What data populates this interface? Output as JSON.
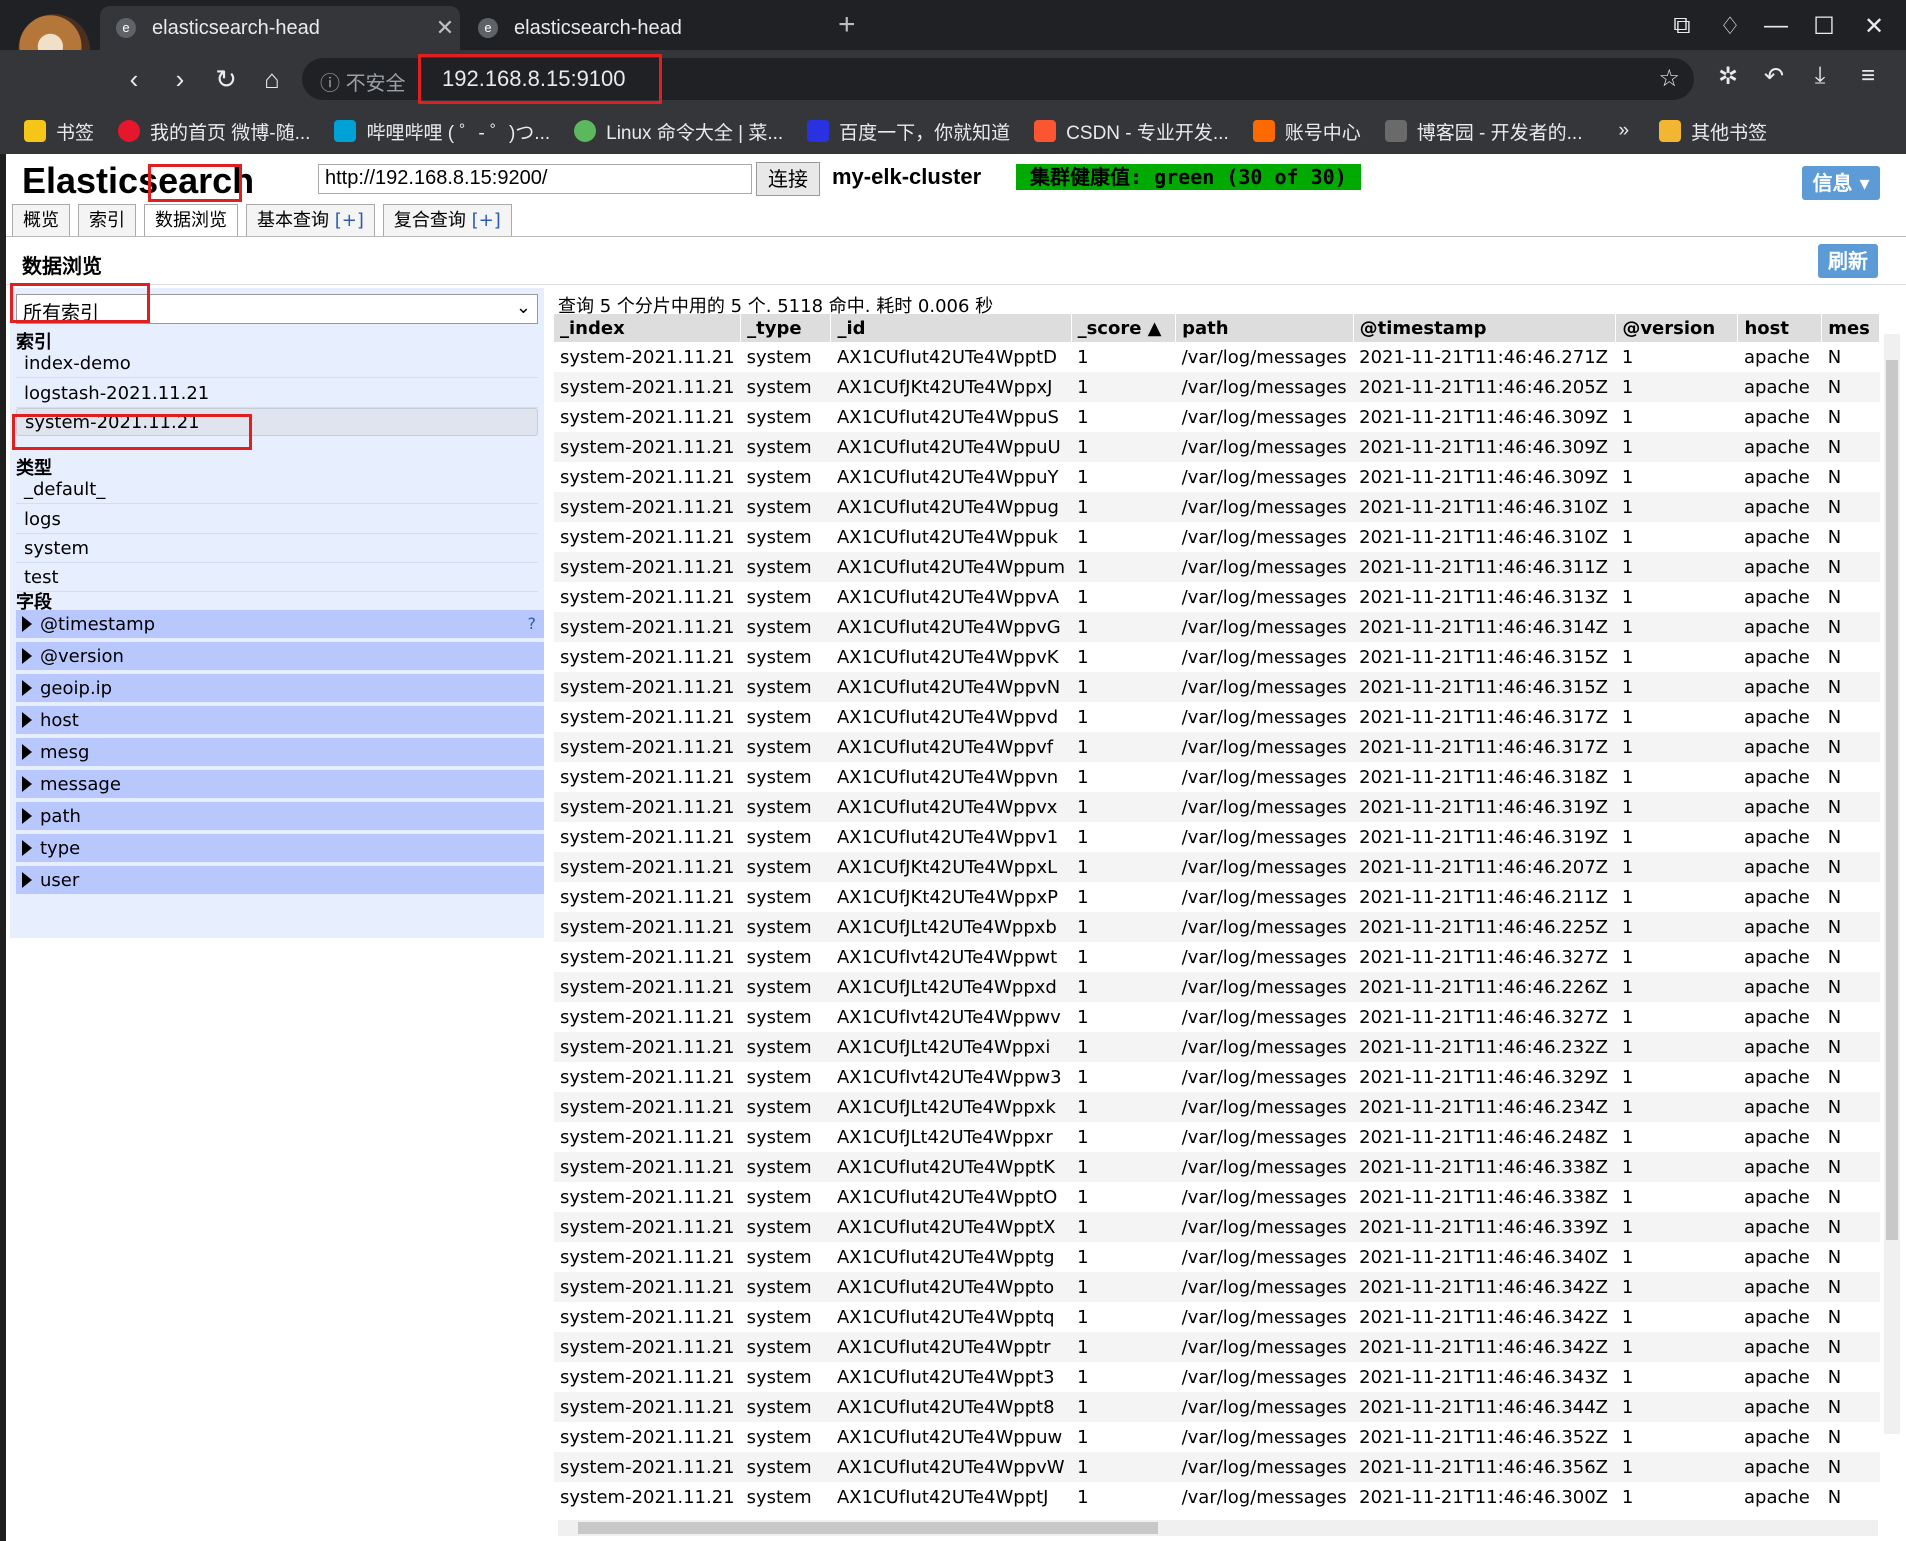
{
  "browser": {
    "tabs": [
      {
        "title": "elasticsearch-head",
        "close": "✕"
      },
      {
        "title": "elasticsearch-head"
      }
    ],
    "new_tab": "+",
    "insecure_label": "不安全",
    "url": "192.168.8.15:9100",
    "bookmarks": [
      {
        "label": "书签",
        "color": "#f5c518"
      },
      {
        "label": "我的首页 微博-随...",
        "color": "#e6162d"
      },
      {
        "label": "哔哩哔哩 ( ゜- ゜)つ...",
        "color": "#00a1d6"
      },
      {
        "label": "Linux 命令大全 | 菜...",
        "color": "#5cb85c"
      },
      {
        "label": "百度一下，你就知道",
        "color": "#2932e1"
      },
      {
        "label": "CSDN - 专业开发...",
        "color": "#fc5531"
      },
      {
        "label": "账号中心",
        "color": "#ff6a00"
      },
      {
        "label": "博客园 - 开发者的...",
        "color": "#6a6a6a"
      }
    ],
    "bookmarks_more": "»",
    "other_bookmarks": "其他书签"
  },
  "es": {
    "logo": "Elasticsearch",
    "connect_url": "http://192.168.8.15:9200/",
    "connect_label": "连接",
    "cluster_name": "my-elk-cluster",
    "health": "集群健康值: green (30 of 30)",
    "health_color": "#00aa00",
    "info_label": "信息 ▾",
    "tabs": [
      {
        "label": "概览"
      },
      {
        "label": "索引"
      },
      {
        "label": "数据浏览"
      },
      {
        "label": "基本查询",
        "plus": "[+]"
      },
      {
        "label": "复合查询",
        "plus": "[+]"
      }
    ],
    "section_title": "数据浏览",
    "refresh_label": "刷新"
  },
  "sidebar": {
    "index_select": "所有索引",
    "indices_heading": "索引",
    "indices": [
      "index-demo",
      "logstash-2021.11.21",
      "system-2021.11.21"
    ],
    "types_heading": "类型",
    "types": [
      "_default_",
      "logs",
      "system",
      "test"
    ],
    "fields_heading": "字段",
    "fields": [
      "@timestamp",
      "@version",
      "geoip.ip",
      "host",
      "mesg",
      "message",
      "path",
      "type",
      "user"
    ],
    "help": "?"
  },
  "results": {
    "summary": "查询 5 个分片中用的 5 个. 5118 命中. 耗时 0.006 秒",
    "columns": [
      "_index",
      "_type",
      "_id",
      "_score ▲",
      "path",
      "@timestamp",
      "@version",
      "host",
      "mes"
    ],
    "rows": [
      [
        "system-2021.11.21",
        "system",
        "AX1CUfIut42UTe4WpptD",
        "1",
        "/var/log/messages",
        "2021-11-21T11:46:46.271Z",
        "1",
        "apache",
        "N"
      ],
      [
        "system-2021.11.21",
        "system",
        "AX1CUfJKt42UTe4WppxJ",
        "1",
        "/var/log/messages",
        "2021-11-21T11:46:46.205Z",
        "1",
        "apache",
        "N"
      ],
      [
        "system-2021.11.21",
        "system",
        "AX1CUfIut42UTe4WppuS",
        "1",
        "/var/log/messages",
        "2021-11-21T11:46:46.309Z",
        "1",
        "apache",
        "N"
      ],
      [
        "system-2021.11.21",
        "system",
        "AX1CUfIut42UTe4WppuU",
        "1",
        "/var/log/messages",
        "2021-11-21T11:46:46.309Z",
        "1",
        "apache",
        "N"
      ],
      [
        "system-2021.11.21",
        "system",
        "AX1CUfIut42UTe4WppuY",
        "1",
        "/var/log/messages",
        "2021-11-21T11:46:46.309Z",
        "1",
        "apache",
        "N"
      ],
      [
        "system-2021.11.21",
        "system",
        "AX1CUfIut42UTe4Wppug",
        "1",
        "/var/log/messages",
        "2021-11-21T11:46:46.310Z",
        "1",
        "apache",
        "N"
      ],
      [
        "system-2021.11.21",
        "system",
        "AX1CUfIut42UTe4Wppuk",
        "1",
        "/var/log/messages",
        "2021-11-21T11:46:46.310Z",
        "1",
        "apache",
        "N"
      ],
      [
        "system-2021.11.21",
        "system",
        "AX1CUfIut42UTe4Wppum",
        "1",
        "/var/log/messages",
        "2021-11-21T11:46:46.311Z",
        "1",
        "apache",
        "N"
      ],
      [
        "system-2021.11.21",
        "system",
        "AX1CUfIut42UTe4WppvA",
        "1",
        "/var/log/messages",
        "2021-11-21T11:46:46.313Z",
        "1",
        "apache",
        "N"
      ],
      [
        "system-2021.11.21",
        "system",
        "AX1CUfIut42UTe4WppvG",
        "1",
        "/var/log/messages",
        "2021-11-21T11:46:46.314Z",
        "1",
        "apache",
        "N"
      ],
      [
        "system-2021.11.21",
        "system",
        "AX1CUfIut42UTe4WppvK",
        "1",
        "/var/log/messages",
        "2021-11-21T11:46:46.315Z",
        "1",
        "apache",
        "N"
      ],
      [
        "system-2021.11.21",
        "system",
        "AX1CUfIut42UTe4WppvN",
        "1",
        "/var/log/messages",
        "2021-11-21T11:46:46.315Z",
        "1",
        "apache",
        "N"
      ],
      [
        "system-2021.11.21",
        "system",
        "AX1CUfIut42UTe4Wppvd",
        "1",
        "/var/log/messages",
        "2021-11-21T11:46:46.317Z",
        "1",
        "apache",
        "N"
      ],
      [
        "system-2021.11.21",
        "system",
        "AX1CUfIut42UTe4Wppvf",
        "1",
        "/var/log/messages",
        "2021-11-21T11:46:46.317Z",
        "1",
        "apache",
        "N"
      ],
      [
        "system-2021.11.21",
        "system",
        "AX1CUfIut42UTe4Wppvn",
        "1",
        "/var/log/messages",
        "2021-11-21T11:46:46.318Z",
        "1",
        "apache",
        "N"
      ],
      [
        "system-2021.11.21",
        "system",
        "AX1CUfIut42UTe4Wppvx",
        "1",
        "/var/log/messages",
        "2021-11-21T11:46:46.319Z",
        "1",
        "apache",
        "N"
      ],
      [
        "system-2021.11.21",
        "system",
        "AX1CUfIut42UTe4Wppv1",
        "1",
        "/var/log/messages",
        "2021-11-21T11:46:46.319Z",
        "1",
        "apache",
        "N"
      ],
      [
        "system-2021.11.21",
        "system",
        "AX1CUfJKt42UTe4WppxL",
        "1",
        "/var/log/messages",
        "2021-11-21T11:46:46.207Z",
        "1",
        "apache",
        "N"
      ],
      [
        "system-2021.11.21",
        "system",
        "AX1CUfJKt42UTe4WppxP",
        "1",
        "/var/log/messages",
        "2021-11-21T11:46:46.211Z",
        "1",
        "apache",
        "N"
      ],
      [
        "system-2021.11.21",
        "system",
        "AX1CUfJLt42UTe4Wppxb",
        "1",
        "/var/log/messages",
        "2021-11-21T11:46:46.225Z",
        "1",
        "apache",
        "N"
      ],
      [
        "system-2021.11.21",
        "system",
        "AX1CUfIvt42UTe4Wppwt",
        "1",
        "/var/log/messages",
        "2021-11-21T11:46:46.327Z",
        "1",
        "apache",
        "N"
      ],
      [
        "system-2021.11.21",
        "system",
        "AX1CUfJLt42UTe4Wppxd",
        "1",
        "/var/log/messages",
        "2021-11-21T11:46:46.226Z",
        "1",
        "apache",
        "N"
      ],
      [
        "system-2021.11.21",
        "system",
        "AX1CUfIvt42UTe4Wppwv",
        "1",
        "/var/log/messages",
        "2021-11-21T11:46:46.327Z",
        "1",
        "apache",
        "N"
      ],
      [
        "system-2021.11.21",
        "system",
        "AX1CUfJLt42UTe4Wppxi",
        "1",
        "/var/log/messages",
        "2021-11-21T11:46:46.232Z",
        "1",
        "apache",
        "N"
      ],
      [
        "system-2021.11.21",
        "system",
        "AX1CUfIvt42UTe4Wppw3",
        "1",
        "/var/log/messages",
        "2021-11-21T11:46:46.329Z",
        "1",
        "apache",
        "N"
      ],
      [
        "system-2021.11.21",
        "system",
        "AX1CUfJLt42UTe4Wppxk",
        "1",
        "/var/log/messages",
        "2021-11-21T11:46:46.234Z",
        "1",
        "apache",
        "N"
      ],
      [
        "system-2021.11.21",
        "system",
        "AX1CUfJLt42UTe4Wppxr",
        "1",
        "/var/log/messages",
        "2021-11-21T11:46:46.248Z",
        "1",
        "apache",
        "N"
      ],
      [
        "system-2021.11.21",
        "system",
        "AX1CUfIut42UTe4WpptK",
        "1",
        "/var/log/messages",
        "2021-11-21T11:46:46.338Z",
        "1",
        "apache",
        "N"
      ],
      [
        "system-2021.11.21",
        "system",
        "AX1CUfIut42UTe4WpptO",
        "1",
        "/var/log/messages",
        "2021-11-21T11:46:46.338Z",
        "1",
        "apache",
        "N"
      ],
      [
        "system-2021.11.21",
        "system",
        "AX1CUfIut42UTe4WpptX",
        "1",
        "/var/log/messages",
        "2021-11-21T11:46:46.339Z",
        "1",
        "apache",
        "N"
      ],
      [
        "system-2021.11.21",
        "system",
        "AX1CUfIut42UTe4Wpptg",
        "1",
        "/var/log/messages",
        "2021-11-21T11:46:46.340Z",
        "1",
        "apache",
        "N"
      ],
      [
        "system-2021.11.21",
        "system",
        "AX1CUfIut42UTe4Wppto",
        "1",
        "/var/log/messages",
        "2021-11-21T11:46:46.342Z",
        "1",
        "apache",
        "N"
      ],
      [
        "system-2021.11.21",
        "system",
        "AX1CUfIut42UTe4Wpptq",
        "1",
        "/var/log/messages",
        "2021-11-21T11:46:46.342Z",
        "1",
        "apache",
        "N"
      ],
      [
        "system-2021.11.21",
        "system",
        "AX1CUfIut42UTe4Wpptr",
        "1",
        "/var/log/messages",
        "2021-11-21T11:46:46.342Z",
        "1",
        "apache",
        "N"
      ],
      [
        "system-2021.11.21",
        "system",
        "AX1CUfIut42UTe4Wppt3",
        "1",
        "/var/log/messages",
        "2021-11-21T11:46:46.343Z",
        "1",
        "apache",
        "N"
      ],
      [
        "system-2021.11.21",
        "system",
        "AX1CUfIut42UTe4Wppt8",
        "1",
        "/var/log/messages",
        "2021-11-21T11:46:46.344Z",
        "1",
        "apache",
        "N"
      ],
      [
        "system-2021.11.21",
        "system",
        "AX1CUfIut42UTe4Wppuw",
        "1",
        "/var/log/messages",
        "2021-11-21T11:46:46.352Z",
        "1",
        "apache",
        "N"
      ],
      [
        "system-2021.11.21",
        "system",
        "AX1CUfIut42UTe4WppvW",
        "1",
        "/var/log/messages",
        "2021-11-21T11:46:46.356Z",
        "1",
        "apache",
        "N"
      ],
      [
        "system-2021.11.21",
        "system",
        "AX1CUfIut42UTe4WpptJ",
        "1",
        "/var/log/messages",
        "2021-11-21T11:46:46.300Z",
        "1",
        "apache",
        "N"
      ]
    ]
  }
}
